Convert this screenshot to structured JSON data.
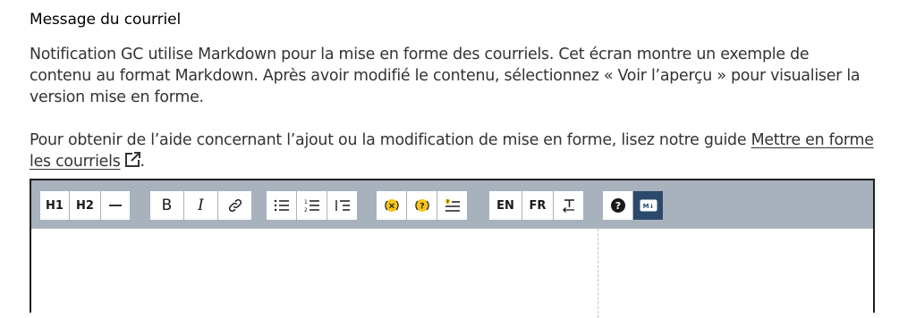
{
  "field": {
    "label": "Message du courriel",
    "description": "Notification GC utilise Markdown pour la mise en forme des courriels. Cet écran montre un exemple de contenu au format Markdown. Après avoir modifié le contenu, sélectionnez « Voir l’aperçu » pour visualiser la version mise en forme.",
    "help_text": "Pour obtenir de l’aide concernant l’ajout ou la modification de mise en forme, lisez notre guide ",
    "help_link": "Mettre en forme les courriels",
    "help_suffix": "."
  },
  "toolbar": {
    "h1": "H1",
    "h2": "H2",
    "bold": "B",
    "italic": "I",
    "english": "EN",
    "french": "FR",
    "markdown_badge": "M↓"
  },
  "colors": {
    "toolbar_bg": "#a8b2bd",
    "editor_border": "#1f1f1f",
    "variable_accent": "#f5c518",
    "markdown_button": "#2b4a6b"
  }
}
